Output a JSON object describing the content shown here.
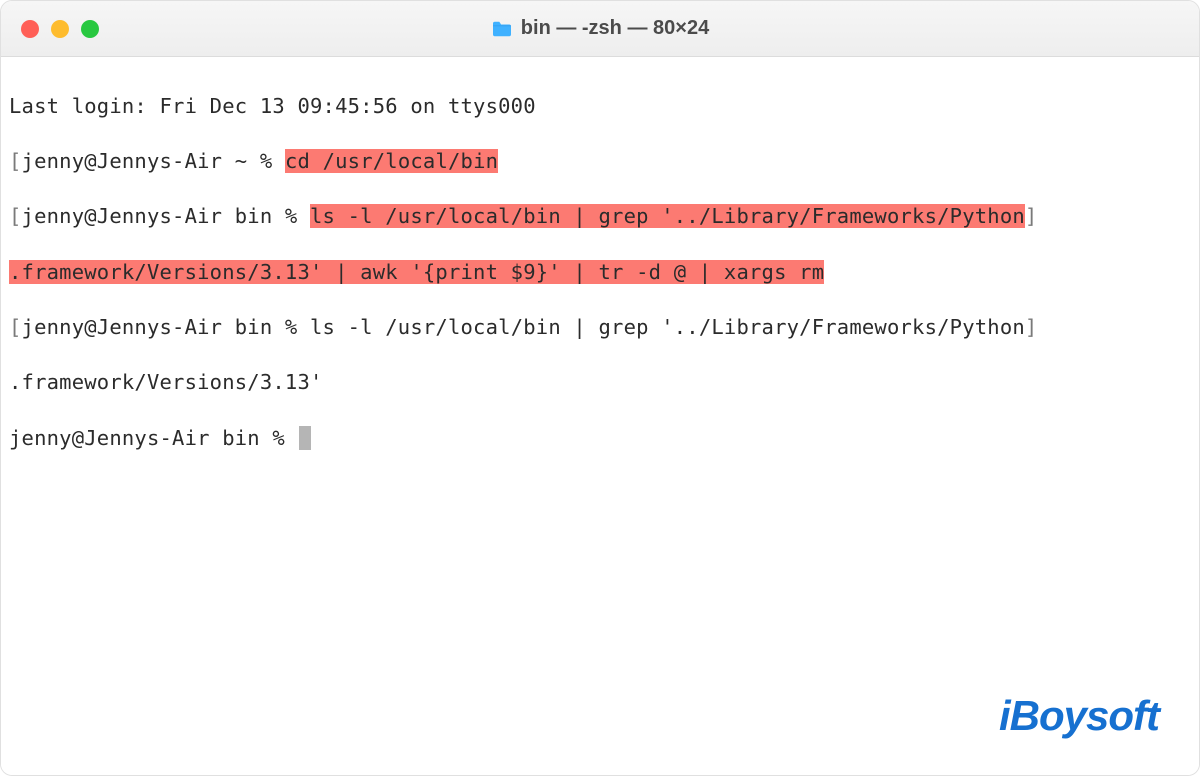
{
  "titlebar": {
    "title": "bin — -zsh — 80×24"
  },
  "terminal": {
    "last_login": "Last login: Fri Dec 13 09:45:56 on ttys000",
    "prompt1_prefix": "jenny@Jennys-Air ~ % ",
    "cmd1_hl": "cd /usr/local/bin",
    "prompt2_prefix": "jenny@Jennys-Air bin % ",
    "cmd2_hl_a": "ls -l /usr/local/bin | grep '../Library/Frameworks/Python",
    "cmd2_hl_b": ".framework/Versions/3.13' | awk '{print $9}' | tr -d @ | xargs rm",
    "prompt3_prefix": "jenny@Jennys-Air bin % ",
    "cmd3_a": "ls -l /usr/local/bin | grep '../Library/Frameworks/Python",
    "cmd3_b": ".framework/Versions/3.13'",
    "prompt4": "jenny@Jennys-Air bin % "
  },
  "watermark": "iBoysoft"
}
